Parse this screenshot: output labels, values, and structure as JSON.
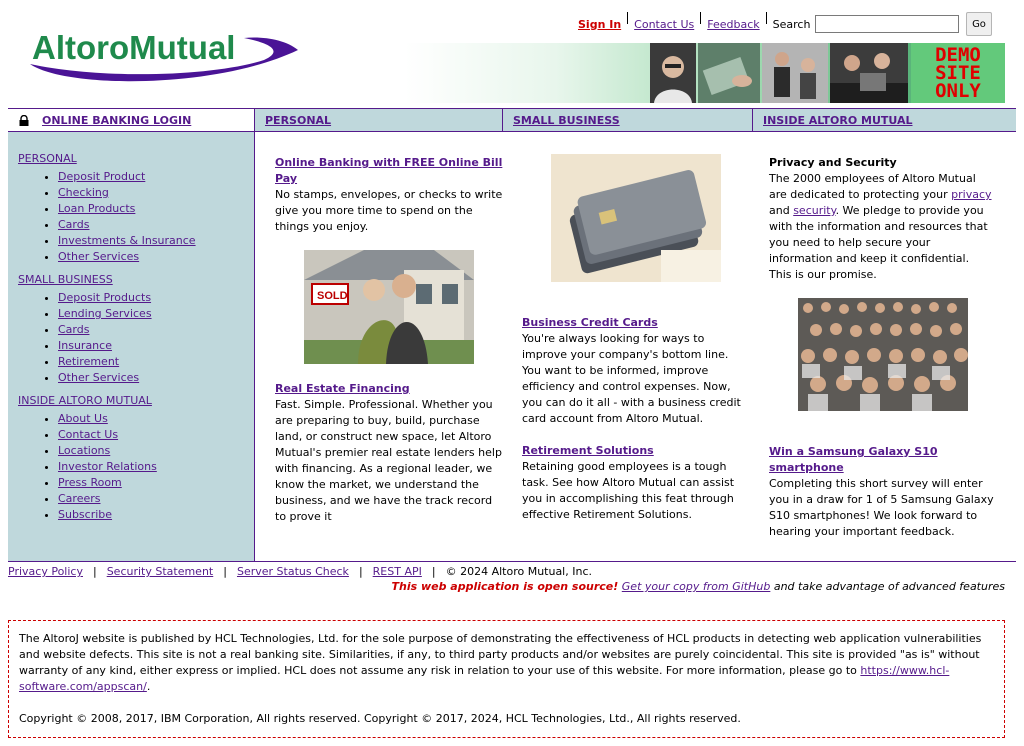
{
  "header": {
    "logo_text": "AltoroMutual",
    "links": {
      "sign_in": "Sign In",
      "contact": "Contact Us",
      "feedback": "Feedback"
    },
    "search_label": "Search",
    "search_value": "",
    "go_label": "Go",
    "demo_badge": "DEMO SITE ONLY"
  },
  "nav": {
    "login": "ONLINE BANKING LOGIN",
    "personal": "PERSONAL",
    "small_business": "SMALL BUSINESS",
    "inside": "INSIDE ALTORO MUTUAL"
  },
  "sidebar": {
    "personal": {
      "title": "PERSONAL",
      "items": [
        "Deposit Product",
        "Checking",
        "Loan Products",
        "Cards",
        "Investments & Insurance",
        "Other Services"
      ]
    },
    "small_business": {
      "title": "SMALL BUSINESS",
      "items": [
        "Deposit Products",
        "Lending Services",
        "Cards",
        "Insurance",
        "Retirement",
        "Other Services"
      ]
    },
    "inside": {
      "title": "INSIDE ALTORO MUTUAL",
      "items": [
        "About Us",
        "Contact Us",
        "Locations",
        "Investor Relations",
        "Press Room",
        "Careers",
        "Subscribe"
      ]
    }
  },
  "col1": {
    "h1": "Online Banking with FREE Online Bill Pay",
    "p1": "No stamps, envelopes, or checks to write give you more time to spend on the things you enjoy.",
    "h2": "Real Estate Financing",
    "p2": "Fast. Simple. Professional. Whether you are preparing to buy, build, purchase land, or construct new space, let Altoro Mutual's premier real estate lenders help with financing. As a regional leader, we know the market, we understand the business, and we have the track record to prove it"
  },
  "col2": {
    "h1": "Business Credit Cards",
    "p1": "You're always looking for ways to improve your company's bottom line. You want to be informed, improve efficiency and control expenses. Now, you can do it all - with a business credit card account from Altoro Mutual.",
    "h2": "Retirement Solutions",
    "p2": "Retaining good employees is a tough task. See how Altoro Mutual can assist you in accomplishing this feat through effective Retirement Solutions."
  },
  "col3": {
    "h1": "Privacy and Security",
    "p1_a": "The 2000 employees of Altoro Mutual are dedicated to protecting your ",
    "privacy": "privacy",
    "p1_b": " and ",
    "security": "security",
    "p1_c": ". We pledge to provide you with the information and resources that you need to help secure your information and keep it confidential. This is our promise.",
    "h2": "Win a Samsung Galaxy S10 smartphone",
    "p2": "Completing this short survey will enter you in a draw for 1 of 5 Samsung Galaxy S10 smartphones! We look forward to hearing your important feedback."
  },
  "footer": {
    "privacy": "Privacy Policy",
    "security": "Security Statement",
    "status": "Server Status Check",
    "rest": "REST API",
    "copyright": "© 2024 Altoro Mutual, Inc.",
    "open_source": "This web application is open source!",
    "github": "Get your copy from GitHub",
    "tail": " and take advantage of advanced features"
  },
  "disclaimer": {
    "text": "The AltoroJ website is published by HCL Technologies, Ltd. for the sole purpose of demonstrating the effectiveness of HCL products in detecting web application vulnerabilities and website defects. This site is not a real banking site. Similarities, if any, to third party products and/or websites are purely coincidental. This site is provided \"as is\" without warranty of any kind, either express or implied. HCL does not assume any risk in relation to your use of this website. For more information, please go to ",
    "link": "https://www.hcl-software.com/appscan/",
    "copyright": "Copyright © 2008, 2017, IBM Corporation, All rights reserved. Copyright © 2017, 2024, HCL Technologies, Ltd., All rights reserved."
  },
  "colors": {
    "accent": "#551a8b",
    "sidebar_bg": "#bfd8dc",
    "logo_green": "#1f8a4c",
    "alert_red": "#cc0000"
  }
}
